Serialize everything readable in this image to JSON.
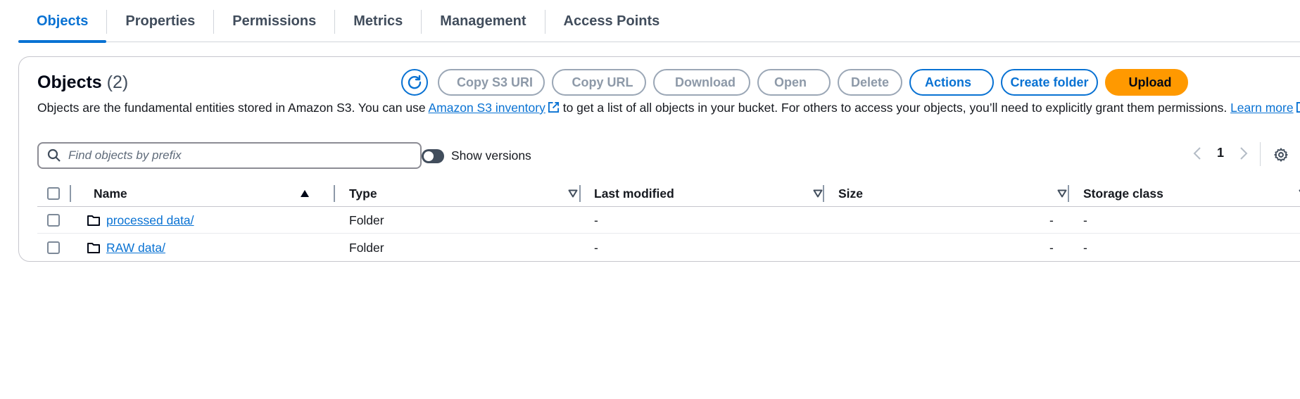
{
  "tabs": [
    "Objects",
    "Properties",
    "Permissions",
    "Metrics",
    "Management",
    "Access Points"
  ],
  "panel": {
    "title": "Objects",
    "count": "(2)",
    "buttons": {
      "copy_s3_uri": "Copy S3 URI",
      "copy_url": "Copy URL",
      "download": "Download",
      "open": "Open",
      "delete": "Delete",
      "actions": "Actions",
      "create_folder": "Create folder",
      "upload": "Upload"
    },
    "description": {
      "part1": "Objects are the fundamental entities stored in Amazon S3. You can use ",
      "link1": "Amazon S3 inventory",
      "part2": " to get a list of all objects in your bucket. For others to access your objects, you’ll need to explicitly grant them permissions. ",
      "link2": "Learn more"
    },
    "search_placeholder": "Find objects by prefix",
    "show_versions": "Show versions",
    "page": "1"
  },
  "table": {
    "headers": [
      "Name",
      "Type",
      "Last modified",
      "Size",
      "Storage class"
    ],
    "rows": [
      {
        "name": "processed data/",
        "type": "Folder",
        "last_modified": "-",
        "size": "-",
        "storage_class": "-"
      },
      {
        "name": "RAW data/",
        "type": "Folder",
        "last_modified": "-",
        "size": "-",
        "storage_class": "-"
      }
    ]
  },
  "colors": {
    "accent": "#0972d3",
    "upload": "#ff9900",
    "disabled": "#8d99a8"
  }
}
